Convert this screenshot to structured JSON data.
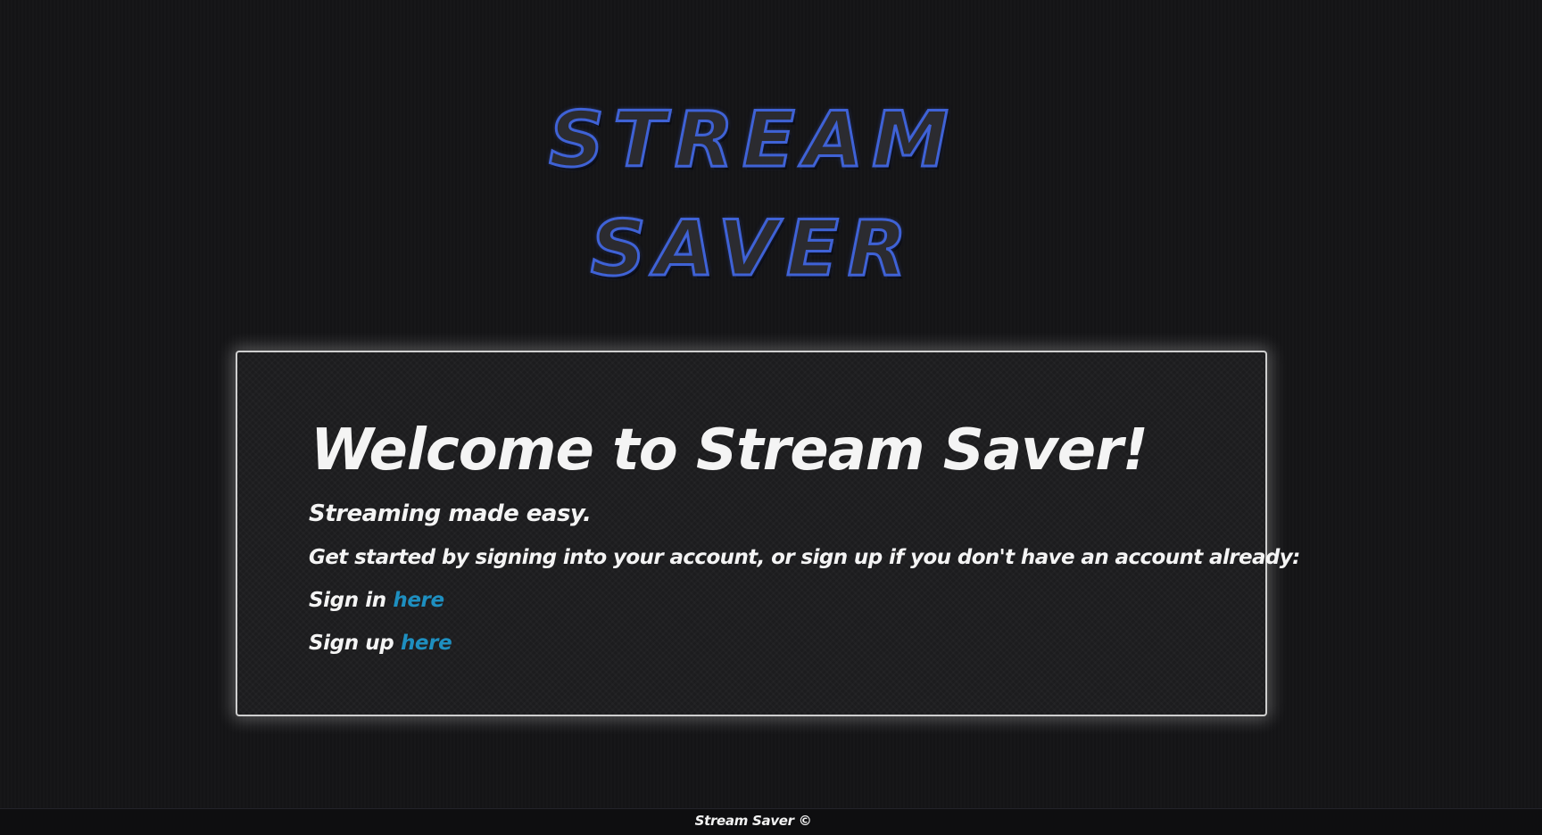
{
  "logo": {
    "line1": "STREAM",
    "line2": "SAVER"
  },
  "card": {
    "title": "Welcome to Stream Saver!",
    "tagline": "Streaming made easy.",
    "intro": "Get started by signing into your account, or sign up if you don't have an account already:",
    "signin_prefix": "Sign in",
    "signin_link": "here",
    "signup_prefix": "Sign up",
    "signup_link": "here"
  },
  "footer": {
    "text": "Stream Saver ©"
  },
  "colors": {
    "background": "#141416",
    "logo_outline": "#3f62d6",
    "link": "#1e8fc0",
    "card_border": "#cfcfcf"
  }
}
